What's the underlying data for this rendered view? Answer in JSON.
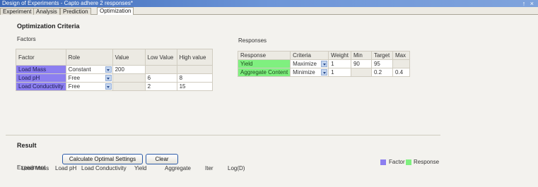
{
  "window": {
    "title": "Design of Experiments - Capto adhere 2 responses*",
    "controls": [
      "↑",
      "×"
    ]
  },
  "tabs": [
    {
      "label": "Experiment",
      "active": false
    },
    {
      "label": "Analysis",
      "active": false
    },
    {
      "label": "Prediction",
      "active": false
    },
    {
      "label": "Optimization",
      "active": true
    }
  ],
  "optimization": {
    "title": "Optimization Criteria",
    "factors_label": "Factors",
    "responses_label": "Responses"
  },
  "factors_table": {
    "headers": {
      "factor": "Factor",
      "role": "Role",
      "value": "Value",
      "low": "Low Value",
      "high": "High value"
    },
    "rows": [
      {
        "factor": "Load Mass",
        "role": "Constant",
        "value": "200",
        "low": "",
        "high": ""
      },
      {
        "factor": "Load pH",
        "role": "Free",
        "value": "",
        "low": "6",
        "high": "8"
      },
      {
        "factor": "Load Conductivity",
        "role": "Free",
        "value": "",
        "low": "2",
        "high": "15"
      }
    ]
  },
  "responses_table": {
    "headers": {
      "response": "Response",
      "criteria": "Criteria",
      "weight": "Weight",
      "min": "Min",
      "target": "Target",
      "max": "Max"
    },
    "rows": [
      {
        "response": "Yield",
        "criteria": "Maximize",
        "weight": "1",
        "min": "90",
        "target": "95",
        "max": ""
      },
      {
        "response": "Aggregate Content",
        "criteria": "Minimize",
        "weight": "1",
        "min": "",
        "target": "0.2",
        "max": "0.4"
      }
    ]
  },
  "result": {
    "title": "Result",
    "calc_button": "Calculate Optimal Settings",
    "clear_button": "Clear",
    "experiment_label": "Experiment",
    "legend": {
      "factor": "Factor",
      "response": "Response"
    },
    "columns": [
      "Load Mass",
      "Load pH",
      "Load Conductivity",
      "Yield",
      "Aggregate",
      "Iter",
      "Log(D)"
    ]
  },
  "colors": {
    "factor": "#8c7ff0",
    "response": "#7ff07f",
    "titlebar": "#3a68b8"
  }
}
